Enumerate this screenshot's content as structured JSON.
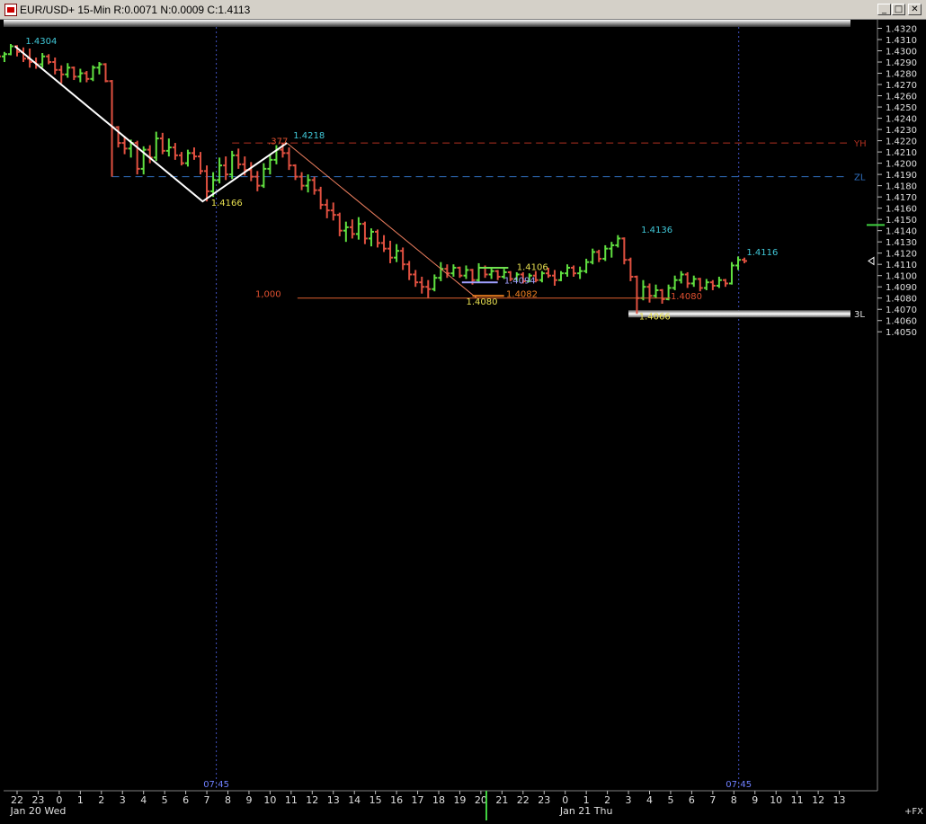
{
  "window": {
    "title": "EUR/USD+ 15-Min R:0.0071 N:0.0009 C:1.4113",
    "buttons": {
      "minimize": "_",
      "maximize": "□",
      "close": "✕"
    }
  },
  "chart_data": {
    "type": "ohlc",
    "symbol": "EUR/USD+",
    "interval": "15-Min",
    "y_range": [
      1.405,
      1.4325
    ],
    "y_ticks": [
      "1.4050",
      "1.4060",
      "1.4070",
      "1.4080",
      "1.4090",
      "1.4100",
      "1.4110",
      "1.4120",
      "1.4130",
      "1.4140",
      "1.4150",
      "1.4160",
      "1.4170",
      "1.4180",
      "1.4190",
      "1.4200",
      "1.4210",
      "1.4220",
      "1.4230",
      "1.4240",
      "1.4250",
      "1.4260",
      "1.4270",
      "1.4280",
      "1.4290",
      "1.4300",
      "1.4310",
      "1.4320"
    ],
    "x_ticks": [
      "22",
      "23",
      "0",
      "1",
      "2",
      "3",
      "4",
      "5",
      "6",
      "7",
      "8",
      "9",
      "10",
      "11",
      "12",
      "13",
      "14",
      "15",
      "16",
      "17",
      "18",
      "19",
      "20",
      "21",
      "22",
      "23",
      "0",
      "1",
      "2",
      "3",
      "4",
      "5",
      "6",
      "7",
      "8",
      "9",
      "10",
      "11",
      "12",
      "13"
    ],
    "date_labels": [
      {
        "text": "Jan 20 Wed",
        "tick": 1
      },
      {
        "text": "Jan 21 Thu",
        "tick": 27
      }
    ],
    "vertical_markers": [
      {
        "label": "07:45",
        "tick": 9.45
      },
      {
        "label": "07:45",
        "tick": 34.23
      }
    ],
    "right_label": "+FX",
    "horizontal_lines": [
      {
        "label": "YH",
        "price": 1.4218,
        "color": "#b03020",
        "style": "dashed",
        "from_tick": 10.2
      },
      {
        "label": "ZL",
        "price": 1.4188,
        "color": "#3070c0",
        "style": "dashed",
        "from_tick": 4.5
      },
      {
        "label": "3L",
        "price": 1.4066,
        "color": "#e0e0e0",
        "style": "band",
        "from_tick": 29.0
      }
    ],
    "zigzag": [
      {
        "tick": -0.1,
        "price": 1.4304
      },
      {
        "tick": 8.8,
        "price": 1.4166
      },
      {
        "tick": 12.8,
        "price": 1.4218
      }
    ],
    "fib_line": {
      "from": {
        "tick": 12.8,
        "price": 1.4218
      },
      "to": {
        "tick": 21.8,
        "price": 1.408
      }
    },
    "price_labels": [
      {
        "text": "1.4304",
        "tick": 0.4,
        "price": 1.4306,
        "color": "#40c8d8"
      },
      {
        "text": "1.4218",
        "tick": 13.1,
        "price": 1.4222,
        "color": "#40c8d8"
      },
      {
        "text": "1.4166",
        "tick": 9.2,
        "price": 1.4162,
        "color": "#e8e050"
      },
      {
        "text": ".377",
        "tick": 11.9,
        "price": 1.4217,
        "color": "#e05030"
      },
      {
        "text": "1.4136",
        "tick": 29.6,
        "price": 1.4138,
        "color": "#40c8d8"
      },
      {
        "text": "1.4116",
        "tick": 34.6,
        "price": 1.4118,
        "color": "#40c8d8"
      },
      {
        "text": "1.4106",
        "tick": 23.7,
        "price": 1.4105,
        "color": "#e8e050"
      },
      {
        "text": "1.4094",
        "tick": 23.1,
        "price": 1.4093,
        "color": "#a0a0ff"
      },
      {
        "text": "1.4082",
        "tick": 23.2,
        "price": 1.4081,
        "color": "#f08020"
      },
      {
        "text": "1.4080",
        "tick": 21.3,
        "price": 1.4074,
        "color": "#e8e050"
      },
      {
        "text": "1.4080",
        "tick": 31.0,
        "price": 1.4079,
        "color": "#e05030"
      },
      {
        "text": "1.4066",
        "tick": 29.5,
        "price": 1.4061,
        "color": "#e8e050"
      },
      {
        "text": "1,000",
        "tick": 11.3,
        "price": 1.4081,
        "color": "#e05030"
      }
    ],
    "level_segments": [
      {
        "price": 1.4094,
        "from_tick": 21.1,
        "to_tick": 22.8,
        "color": "#a0a0ff"
      },
      {
        "price": 1.4082,
        "from_tick": 21.6,
        "to_tick": 23.1,
        "color": "#f08020"
      },
      {
        "price": 1.4107,
        "from_tick": 21.9,
        "to_tick": 23.3,
        "color": "#70e050"
      },
      {
        "price": 1.408,
        "from_tick": 13.3,
        "to_tick": 31.0,
        "color": "#e06030"
      }
    ],
    "bars": [
      [
        -0.9,
        1.4298,
        1.4291,
        1.4297,
        1.4295
      ],
      [
        -0.6,
        1.4295,
        1.4299,
        1.429,
        1.4297
      ],
      [
        -0.3,
        1.4297,
        1.4306,
        1.4296,
        1.4304
      ],
      [
        0.0,
        1.4304,
        1.4305,
        1.4295,
        1.4299
      ],
      [
        0.3,
        1.4299,
        1.4303,
        1.429,
        1.4293
      ],
      [
        0.6,
        1.4293,
        1.4302,
        1.4285,
        1.429
      ],
      [
        0.9,
        1.429,
        1.4294,
        1.4284,
        1.4288
      ],
      [
        1.2,
        1.4288,
        1.4298,
        1.4285,
        1.4295
      ],
      [
        1.5,
        1.4295,
        1.4297,
        1.4288,
        1.429
      ],
      [
        1.8,
        1.429,
        1.4294,
        1.4279,
        1.4283
      ],
      [
        2.1,
        1.4283,
        1.4287,
        1.4271,
        1.4279
      ],
      [
        2.4,
        1.4279,
        1.4289,
        1.4276,
        1.4285
      ],
      [
        2.7,
        1.4285,
        1.4286,
        1.4274,
        1.4277
      ],
      [
        3.0,
        1.4277,
        1.4284,
        1.4272,
        1.428
      ],
      [
        3.3,
        1.428,
        1.4282,
        1.4272,
        1.4275
      ],
      [
        3.6,
        1.4275,
        1.4287,
        1.4273,
        1.4285
      ],
      [
        3.9,
        1.4285,
        1.429,
        1.4279,
        1.4288
      ],
      [
        4.2,
        1.4288,
        1.4289,
        1.4272,
        1.4273
      ],
      [
        4.5,
        1.4273,
        1.4274,
        1.4188,
        1.4232
      ],
      [
        4.8,
        1.4232,
        1.4233,
        1.4214,
        1.4218
      ],
      [
        5.1,
        1.4218,
        1.4224,
        1.4208,
        1.4213
      ],
      [
        5.4,
        1.4213,
        1.4221,
        1.4205,
        1.4218
      ],
      [
        5.7,
        1.4218,
        1.422,
        1.419,
        1.4195
      ],
      [
        6.0,
        1.4195,
        1.4215,
        1.419,
        1.4212
      ],
      [
        6.3,
        1.4212,
        1.4216,
        1.42,
        1.4205
      ],
      [
        6.6,
        1.4205,
        1.4228,
        1.4202,
        1.4222
      ],
      [
        6.9,
        1.4222,
        1.4227,
        1.4208,
        1.4211
      ],
      [
        7.2,
        1.4211,
        1.4222,
        1.4206,
        1.4214
      ],
      [
        7.5,
        1.4214,
        1.4218,
        1.4203,
        1.4207
      ],
      [
        7.8,
        1.4207,
        1.421,
        1.4198,
        1.42
      ],
      [
        8.1,
        1.42,
        1.4212,
        1.4197,
        1.4209
      ],
      [
        8.4,
        1.4209,
        1.4214,
        1.4203,
        1.4206
      ],
      [
        8.7,
        1.4206,
        1.421,
        1.419,
        1.4193
      ],
      [
        9.0,
        1.4193,
        1.4198,
        1.4166,
        1.4175
      ],
      [
        9.3,
        1.4175,
        1.4192,
        1.417,
        1.4185
      ],
      [
        9.6,
        1.4185,
        1.4205,
        1.4182,
        1.4198
      ],
      [
        9.9,
        1.4198,
        1.4206,
        1.4185,
        1.419
      ],
      [
        10.2,
        1.419,
        1.4211,
        1.4186,
        1.4207
      ],
      [
        10.5,
        1.4207,
        1.4213,
        1.4195,
        1.4199
      ],
      [
        10.8,
        1.4199,
        1.4206,
        1.4189,
        1.4194
      ],
      [
        11.1,
        1.4194,
        1.4201,
        1.4184,
        1.4188
      ],
      [
        11.4,
        1.4188,
        1.4193,
        1.4175,
        1.418
      ],
      [
        11.7,
        1.418,
        1.42,
        1.4178,
        1.4195
      ],
      [
        12.0,
        1.4195,
        1.4208,
        1.419,
        1.4203
      ],
      [
        12.3,
        1.4203,
        1.4216,
        1.4199,
        1.4212
      ],
      [
        12.6,
        1.4212,
        1.4218,
        1.4205,
        1.4209
      ],
      [
        12.9,
        1.4209,
        1.4214,
        1.4194,
        1.4198
      ],
      [
        13.2,
        1.4198,
        1.4199,
        1.4185,
        1.4188
      ],
      [
        13.5,
        1.4188,
        1.4192,
        1.4176,
        1.418
      ],
      [
        13.8,
        1.418,
        1.419,
        1.4174,
        1.4185
      ],
      [
        14.1,
        1.4185,
        1.4188,
        1.4172,
        1.4176
      ],
      [
        14.4,
        1.4176,
        1.4179,
        1.4159,
        1.4163
      ],
      [
        14.7,
        1.4163,
        1.4168,
        1.4151,
        1.4158
      ],
      [
        15.0,
        1.4158,
        1.4165,
        1.4149,
        1.4154
      ],
      [
        15.3,
        1.4154,
        1.4156,
        1.4135,
        1.414
      ],
      [
        15.6,
        1.414,
        1.4148,
        1.413,
        1.4143
      ],
      [
        15.9,
        1.4143,
        1.415,
        1.4133,
        1.4137
      ],
      [
        16.2,
        1.4137,
        1.4152,
        1.4132,
        1.4146
      ],
      [
        16.5,
        1.4146,
        1.4148,
        1.4128,
        1.4133
      ],
      [
        16.8,
        1.4133,
        1.4142,
        1.4126,
        1.4139
      ],
      [
        17.1,
        1.4139,
        1.4141,
        1.4125,
        1.4129
      ],
      [
        17.4,
        1.4129,
        1.4136,
        1.4121,
        1.4124
      ],
      [
        17.7,
        1.4124,
        1.4131,
        1.4111,
        1.4116
      ],
      [
        18.0,
        1.4116,
        1.4128,
        1.4112,
        1.4122
      ],
      [
        18.3,
        1.4122,
        1.4125,
        1.4105,
        1.411
      ],
      [
        18.6,
        1.411,
        1.4113,
        1.4096,
        1.4101
      ],
      [
        18.9,
        1.4101,
        1.4105,
        1.409,
        1.4094
      ],
      [
        19.2,
        1.4094,
        1.4099,
        1.4084,
        1.409
      ],
      [
        19.5,
        1.409,
        1.4096,
        1.408,
        1.4088
      ],
      [
        19.8,
        1.4088,
        1.4101,
        1.4086,
        1.4098
      ],
      [
        20.1,
        1.4098,
        1.4112,
        1.4095,
        1.4106
      ],
      [
        20.4,
        1.4106,
        1.411,
        1.4098,
        1.4102
      ],
      [
        20.7,
        1.4102,
        1.411,
        1.4099,
        1.4107
      ],
      [
        21.0,
        1.4107,
        1.4108,
        1.4098,
        1.41
      ],
      [
        21.3,
        1.41,
        1.4109,
        1.4097,
        1.4105
      ],
      [
        21.6,
        1.4105,
        1.4106,
        1.4092,
        1.4096
      ],
      [
        21.9,
        1.4096,
        1.4111,
        1.4094,
        1.4107
      ],
      [
        22.2,
        1.4107,
        1.4109,
        1.4098,
        1.4101
      ],
      [
        22.5,
        1.4101,
        1.4107,
        1.4097,
        1.4104
      ],
      [
        22.8,
        1.4104,
        1.4105,
        1.4096,
        1.4099
      ],
      [
        23.1,
        1.4099,
        1.4106,
        1.4097,
        1.4103
      ],
      [
        23.4,
        1.4103,
        1.4104,
        1.4095,
        1.4097
      ],
      [
        23.7,
        1.4097,
        1.4103,
        1.4095,
        1.4101
      ],
      [
        24.0,
        1.4101,
        1.4103,
        1.4093,
        1.4095
      ],
      [
        24.3,
        1.4095,
        1.4102,
        1.4094,
        1.41
      ],
      [
        24.6,
        1.41,
        1.4104,
        1.4094,
        1.4096
      ],
      [
        24.9,
        1.4096,
        1.4104,
        1.4094,
        1.4102
      ],
      [
        25.2,
        1.4102,
        1.4107,
        1.4098,
        1.41
      ],
      [
        25.5,
        1.41,
        1.4105,
        1.4091,
        1.4096
      ],
      [
        25.8,
        1.4096,
        1.4104,
        1.4095,
        1.4102
      ],
      [
        26.1,
        1.4102,
        1.411,
        1.4099,
        1.4107
      ],
      [
        26.4,
        1.4107,
        1.4109,
        1.4099,
        1.4102
      ],
      [
        26.7,
        1.4102,
        1.4108,
        1.4097,
        1.4104
      ],
      [
        27.0,
        1.4104,
        1.4115,
        1.4102,
        1.4112
      ],
      [
        27.3,
        1.4112,
        1.4124,
        1.411,
        1.4121
      ],
      [
        27.6,
        1.4121,
        1.4123,
        1.4112,
        1.4115
      ],
      [
        27.9,
        1.4115,
        1.4127,
        1.4113,
        1.4124
      ],
      [
        28.2,
        1.4124,
        1.413,
        1.4116,
        1.4127
      ],
      [
        28.5,
        1.4127,
        1.4136,
        1.4125,
        1.4133
      ],
      [
        28.8,
        1.4133,
        1.4134,
        1.411,
        1.4114
      ],
      [
        29.1,
        1.4114,
        1.4116,
        1.4095,
        1.4099
      ],
      [
        29.4,
        1.4099,
        1.41,
        1.4066,
        1.408
      ],
      [
        29.7,
        1.408,
        1.4096,
        1.4078,
        1.409
      ],
      [
        30.0,
        1.409,
        1.4093,
        1.4076,
        1.4082
      ],
      [
        30.3,
        1.4082,
        1.4092,
        1.408,
        1.4087
      ],
      [
        30.6,
        1.4087,
        1.4088,
        1.4075,
        1.4079
      ],
      [
        30.9,
        1.4079,
        1.4092,
        1.4078,
        1.4089
      ],
      [
        31.2,
        1.4089,
        1.41,
        1.4087,
        1.4096
      ],
      [
        31.5,
        1.4096,
        1.4104,
        1.4093,
        1.4101
      ],
      [
        31.8,
        1.4101,
        1.4103,
        1.4089,
        1.4093
      ],
      [
        32.1,
        1.4093,
        1.41,
        1.409,
        1.4097
      ],
      [
        32.4,
        1.4097,
        1.4098,
        1.4086,
        1.4089
      ],
      [
        32.7,
        1.4089,
        1.4097,
        1.4087,
        1.4094
      ],
      [
        33.0,
        1.4094,
        1.4096,
        1.4087,
        1.4091
      ],
      [
        33.3,
        1.4091,
        1.4099,
        1.4089,
        1.4096
      ],
      [
        33.6,
        1.4096,
        1.4097,
        1.409,
        1.4093
      ],
      [
        33.9,
        1.4093,
        1.4112,
        1.4092,
        1.4109
      ],
      [
        34.2,
        1.4109,
        1.4117,
        1.4105,
        1.4114
      ],
      [
        34.5,
        1.4114,
        1.4116,
        1.4111,
        1.4113
      ]
    ]
  }
}
